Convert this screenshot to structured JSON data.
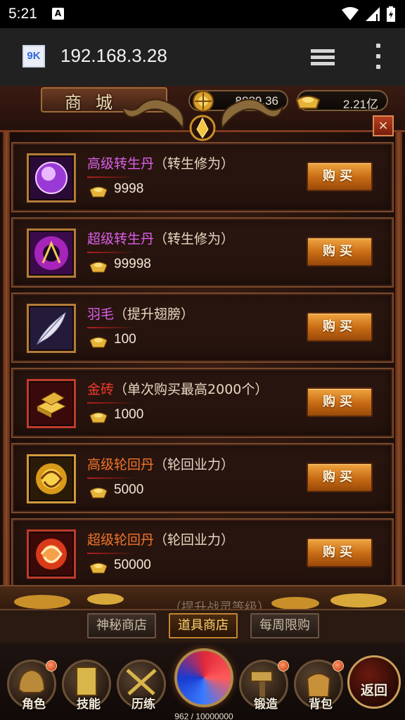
{
  "status_bar": {
    "time": "5:21",
    "notification_icon": "A"
  },
  "browser": {
    "url": "192.168.3.28",
    "favicon_text": "9K"
  },
  "shop": {
    "title": "商城",
    "currency_gem": "8889.36",
    "currency_gold": "2.21亿",
    "close_label": "×",
    "items": [
      {
        "name": "高级转生丹",
        "note": "（转生修为）",
        "price": "9998",
        "buy_label": "购买",
        "name_color": "#d95fe8",
        "icon": "purple-orb-icon"
      },
      {
        "name": "超级转生丹",
        "note": "（转生修为）",
        "price": "99998",
        "buy_label": "购买",
        "name_color": "#d95fe8",
        "icon": "magic-pill-icon"
      },
      {
        "name": "羽毛",
        "note": "（提升翅膀）",
        "price": "100",
        "buy_label": "购买",
        "name_color": "#d95fe8",
        "icon": "feather-icon"
      },
      {
        "name": "金砖",
        "note": "（单次购买最高2000个）",
        "price": "1000",
        "buy_label": "购买",
        "name_color": "#ef3a2a",
        "icon": "gold-brick-icon"
      },
      {
        "name": "高级轮回丹",
        "note": "（轮回业力）",
        "price": "5000",
        "buy_label": "购买",
        "name_color": "#f0742a",
        "icon": "golden-swirl-icon"
      },
      {
        "name": "超级轮回丹",
        "note": "（轮回业力）",
        "price": "50000",
        "buy_label": "购买",
        "name_color": "#f0742a",
        "icon": "fire-swirl-icon"
      }
    ],
    "peek_text": "（提升战灵等级）"
  },
  "tabs": [
    {
      "label": "神秘商店",
      "active": false
    },
    {
      "label": "道具商店",
      "active": true
    },
    {
      "label": "每周限购",
      "active": false
    }
  ],
  "nav": {
    "items": [
      "角色",
      "技能",
      "历练",
      "锻造",
      "背包"
    ],
    "exp": "962 / 10000000",
    "back_label": "返回"
  }
}
